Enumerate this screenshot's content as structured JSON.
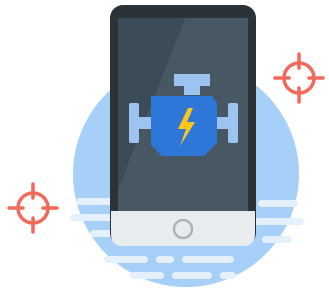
{
  "illustration": {
    "icons": {
      "phone": "smartphone-icon",
      "engine": "engine-icon",
      "bolt": "lightning-bolt-icon",
      "home_button": "home-button-icon",
      "crosshair_left": "crosshair-icon",
      "crosshair_right": "crosshair-icon"
    },
    "colors": {
      "backdrop_circle": "#a6d0f8",
      "speed_lines": "#e4f1fd",
      "phone_frame": "#2b3338",
      "phone_screen": "#3b4b57",
      "screen_glare": "#475864",
      "phone_bottom_panel": "#e8ecef",
      "home_button_ring": "#aab3ba",
      "engine_body": "#2e77d9",
      "engine_parts": "#9dc3f0",
      "bolt": "#ffc61a",
      "crosshair": "#f26a5b"
    }
  }
}
